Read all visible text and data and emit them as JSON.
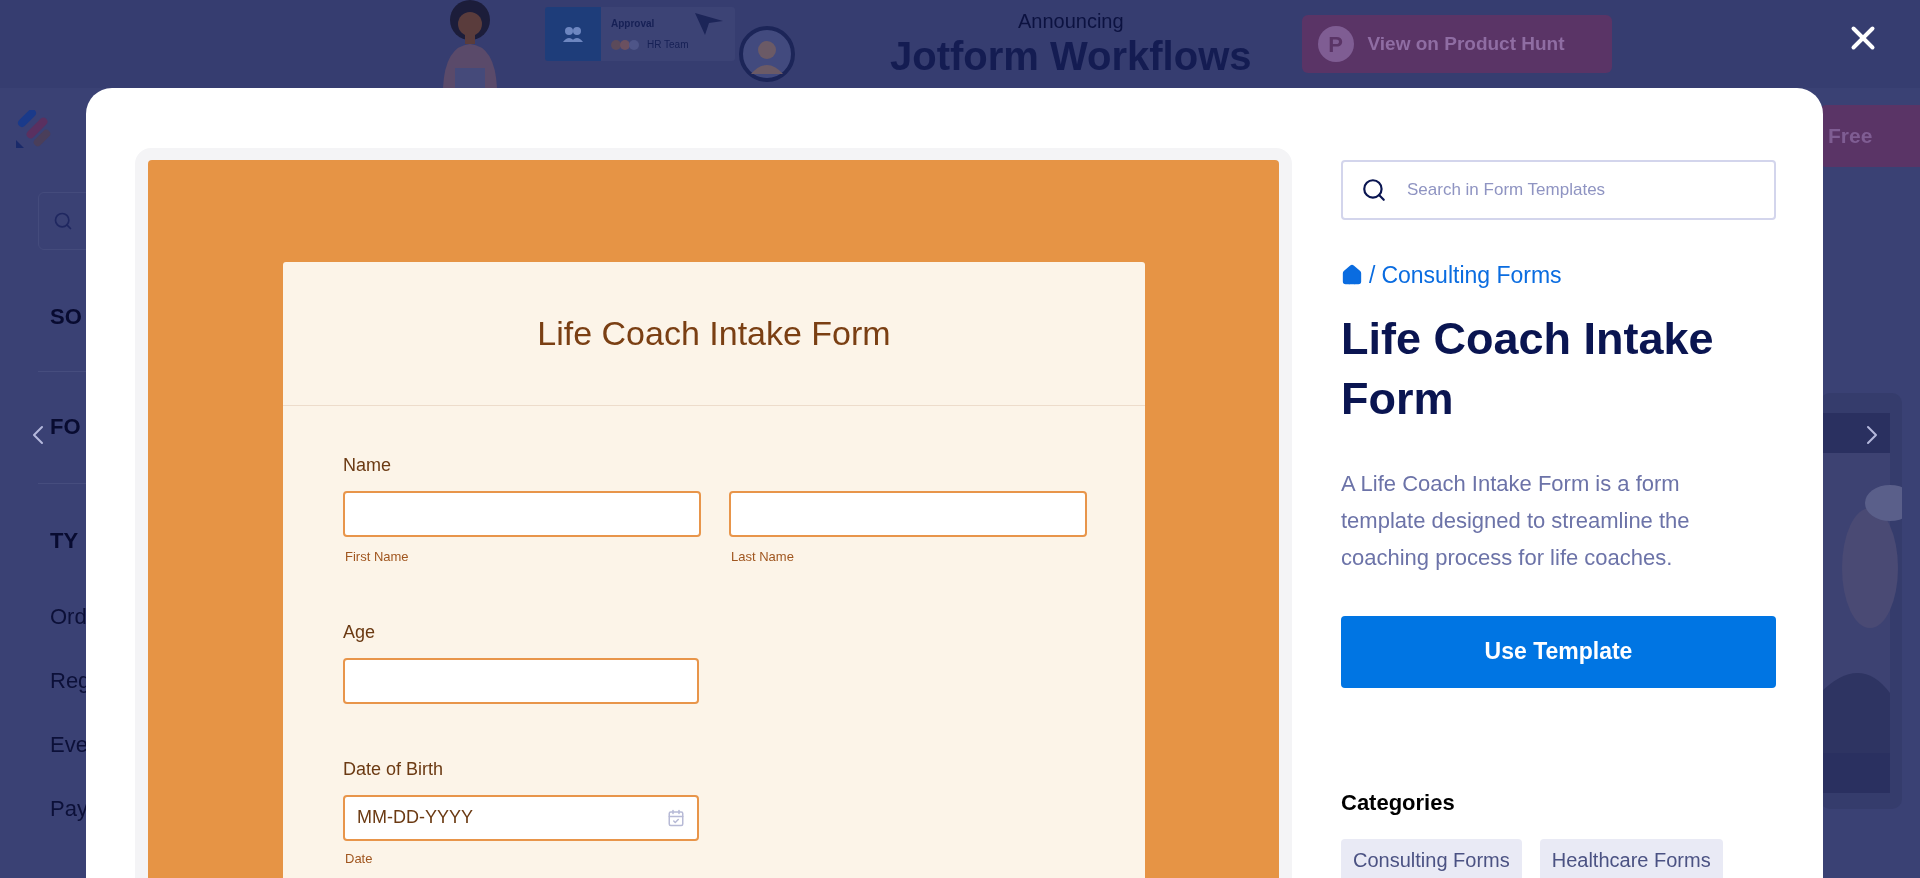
{
  "banner": {
    "approval_card": {
      "title": "Approval",
      "team": "HR Team"
    },
    "announcing": "Announcing",
    "title": "Jotform Workflows",
    "button_badge": "P",
    "button": "View on Product Hunt"
  },
  "background_page": {
    "header_button": "Free",
    "sidebar_headings": [
      "SO",
      "FO",
      "TY"
    ],
    "sidebar_items": [
      "Ord",
      "Reg",
      "Eve",
      "Pay"
    ]
  },
  "modal": {
    "preview": {
      "form_title": "Life Coach Intake Form",
      "fields": [
        {
          "kind": "name",
          "label": "Name",
          "sublabels": [
            "First Name",
            "Last Name"
          ]
        },
        {
          "kind": "text",
          "label": "Age"
        },
        {
          "kind": "date",
          "label": "Date of Birth",
          "placeholder": "MM-DD-YYYY",
          "sublabel": "Date"
        }
      ]
    },
    "search": {
      "placeholder": "Search in Form Templates"
    },
    "breadcrumb": {
      "separator": "/",
      "current": "Consulting Forms"
    },
    "title": "Life Coach Intake Form",
    "description": "A Life Coach Intake Form is a form template designed to streamline the coaching process for life coaches.",
    "button": "Use Template",
    "categories": {
      "heading": "Categories",
      "tags": [
        "Consulting Forms",
        "Healthcare Forms"
      ]
    }
  }
}
